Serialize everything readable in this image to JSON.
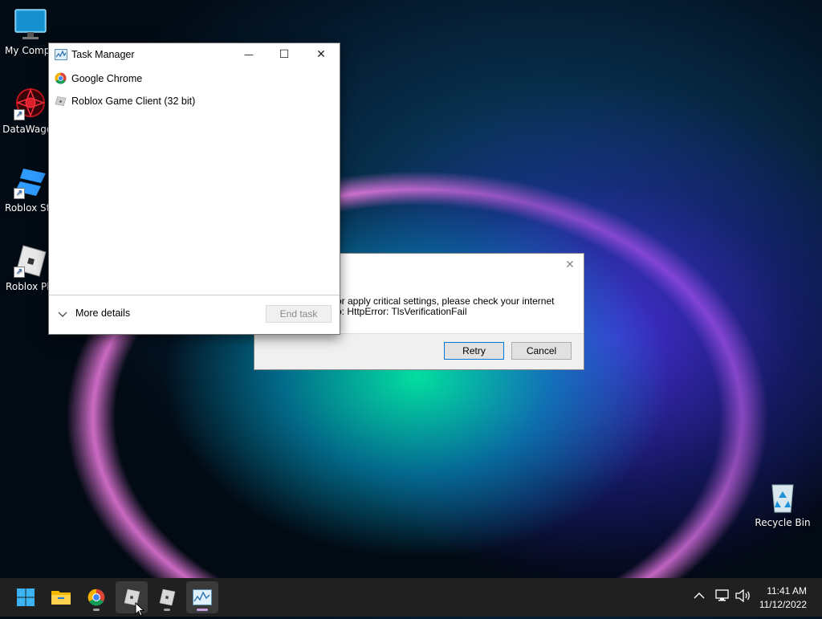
{
  "desktop": {
    "icons": [
      {
        "label": "My Compu"
      },
      {
        "label": "DataWagon"
      },
      {
        "label": "Roblox Stu"
      },
      {
        "label": "Roblox Pla"
      }
    ],
    "recycle_bin": {
      "label": "Recycle Bin"
    }
  },
  "dialog": {
    "message_line1": "d or apply critical settings, please check your internet",
    "message_line2": "nfo: HttpError: TlsVerificationFail",
    "retry_label": "Retry",
    "cancel_label": "Cancel",
    "close_glyph": "✕"
  },
  "task_manager": {
    "title": "Task Manager",
    "minimize_glyph": "—",
    "maximize_glyph": "☐",
    "close_glyph": "✕",
    "processes": [
      {
        "name": "Google Chrome"
      },
      {
        "name": "Roblox Game Client (32 bit)"
      }
    ],
    "more_details_label": "More details",
    "end_task_label": "End task"
  },
  "taskbar": {
    "time": "11:41 AM",
    "date": "11/12/2022",
    "tray_chevron": "^"
  },
  "colors": {
    "accent": "#0078d7",
    "taskbar_bg": "#202020",
    "disabled_text": "#8a8a8a"
  }
}
